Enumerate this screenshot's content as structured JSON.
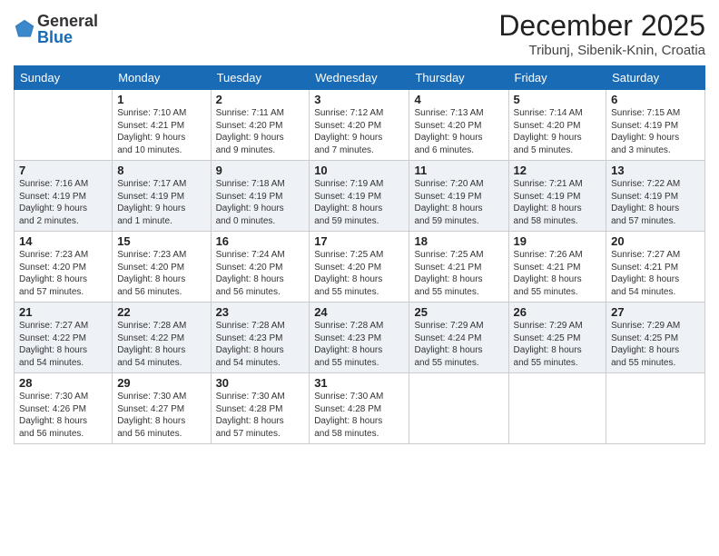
{
  "logo": {
    "general": "General",
    "blue": "Blue"
  },
  "header": {
    "month_year": "December 2025",
    "location": "Tribunj, Sibenik-Knin, Croatia"
  },
  "days_of_week": [
    "Sunday",
    "Monday",
    "Tuesday",
    "Wednesday",
    "Thursday",
    "Friday",
    "Saturday"
  ],
  "weeks": [
    [
      {
        "day": "",
        "info": ""
      },
      {
        "day": "1",
        "info": "Sunrise: 7:10 AM\nSunset: 4:21 PM\nDaylight: 9 hours\nand 10 minutes."
      },
      {
        "day": "2",
        "info": "Sunrise: 7:11 AM\nSunset: 4:20 PM\nDaylight: 9 hours\nand 9 minutes."
      },
      {
        "day": "3",
        "info": "Sunrise: 7:12 AM\nSunset: 4:20 PM\nDaylight: 9 hours\nand 7 minutes."
      },
      {
        "day": "4",
        "info": "Sunrise: 7:13 AM\nSunset: 4:20 PM\nDaylight: 9 hours\nand 6 minutes."
      },
      {
        "day": "5",
        "info": "Sunrise: 7:14 AM\nSunset: 4:20 PM\nDaylight: 9 hours\nand 5 minutes."
      },
      {
        "day": "6",
        "info": "Sunrise: 7:15 AM\nSunset: 4:19 PM\nDaylight: 9 hours\nand 3 minutes."
      }
    ],
    [
      {
        "day": "7",
        "info": "Sunrise: 7:16 AM\nSunset: 4:19 PM\nDaylight: 9 hours\nand 2 minutes."
      },
      {
        "day": "8",
        "info": "Sunrise: 7:17 AM\nSunset: 4:19 PM\nDaylight: 9 hours\nand 1 minute."
      },
      {
        "day": "9",
        "info": "Sunrise: 7:18 AM\nSunset: 4:19 PM\nDaylight: 9 hours\nand 0 minutes."
      },
      {
        "day": "10",
        "info": "Sunrise: 7:19 AM\nSunset: 4:19 PM\nDaylight: 8 hours\nand 59 minutes."
      },
      {
        "day": "11",
        "info": "Sunrise: 7:20 AM\nSunset: 4:19 PM\nDaylight: 8 hours\nand 59 minutes."
      },
      {
        "day": "12",
        "info": "Sunrise: 7:21 AM\nSunset: 4:19 PM\nDaylight: 8 hours\nand 58 minutes."
      },
      {
        "day": "13",
        "info": "Sunrise: 7:22 AM\nSunset: 4:19 PM\nDaylight: 8 hours\nand 57 minutes."
      }
    ],
    [
      {
        "day": "14",
        "info": "Sunrise: 7:23 AM\nSunset: 4:20 PM\nDaylight: 8 hours\nand 57 minutes."
      },
      {
        "day": "15",
        "info": "Sunrise: 7:23 AM\nSunset: 4:20 PM\nDaylight: 8 hours\nand 56 minutes."
      },
      {
        "day": "16",
        "info": "Sunrise: 7:24 AM\nSunset: 4:20 PM\nDaylight: 8 hours\nand 56 minutes."
      },
      {
        "day": "17",
        "info": "Sunrise: 7:25 AM\nSunset: 4:20 PM\nDaylight: 8 hours\nand 55 minutes."
      },
      {
        "day": "18",
        "info": "Sunrise: 7:25 AM\nSunset: 4:21 PM\nDaylight: 8 hours\nand 55 minutes."
      },
      {
        "day": "19",
        "info": "Sunrise: 7:26 AM\nSunset: 4:21 PM\nDaylight: 8 hours\nand 55 minutes."
      },
      {
        "day": "20",
        "info": "Sunrise: 7:27 AM\nSunset: 4:21 PM\nDaylight: 8 hours\nand 54 minutes."
      }
    ],
    [
      {
        "day": "21",
        "info": "Sunrise: 7:27 AM\nSunset: 4:22 PM\nDaylight: 8 hours\nand 54 minutes."
      },
      {
        "day": "22",
        "info": "Sunrise: 7:28 AM\nSunset: 4:22 PM\nDaylight: 8 hours\nand 54 minutes."
      },
      {
        "day": "23",
        "info": "Sunrise: 7:28 AM\nSunset: 4:23 PM\nDaylight: 8 hours\nand 54 minutes."
      },
      {
        "day": "24",
        "info": "Sunrise: 7:28 AM\nSunset: 4:23 PM\nDaylight: 8 hours\nand 55 minutes."
      },
      {
        "day": "25",
        "info": "Sunrise: 7:29 AM\nSunset: 4:24 PM\nDaylight: 8 hours\nand 55 minutes."
      },
      {
        "day": "26",
        "info": "Sunrise: 7:29 AM\nSunset: 4:25 PM\nDaylight: 8 hours\nand 55 minutes."
      },
      {
        "day": "27",
        "info": "Sunrise: 7:29 AM\nSunset: 4:25 PM\nDaylight: 8 hours\nand 55 minutes."
      }
    ],
    [
      {
        "day": "28",
        "info": "Sunrise: 7:30 AM\nSunset: 4:26 PM\nDaylight: 8 hours\nand 56 minutes."
      },
      {
        "day": "29",
        "info": "Sunrise: 7:30 AM\nSunset: 4:27 PM\nDaylight: 8 hours\nand 56 minutes."
      },
      {
        "day": "30",
        "info": "Sunrise: 7:30 AM\nSunset: 4:28 PM\nDaylight: 8 hours\nand 57 minutes."
      },
      {
        "day": "31",
        "info": "Sunrise: 7:30 AM\nSunset: 4:28 PM\nDaylight: 8 hours\nand 58 minutes."
      },
      {
        "day": "",
        "info": ""
      },
      {
        "day": "",
        "info": ""
      },
      {
        "day": "",
        "info": ""
      }
    ]
  ]
}
